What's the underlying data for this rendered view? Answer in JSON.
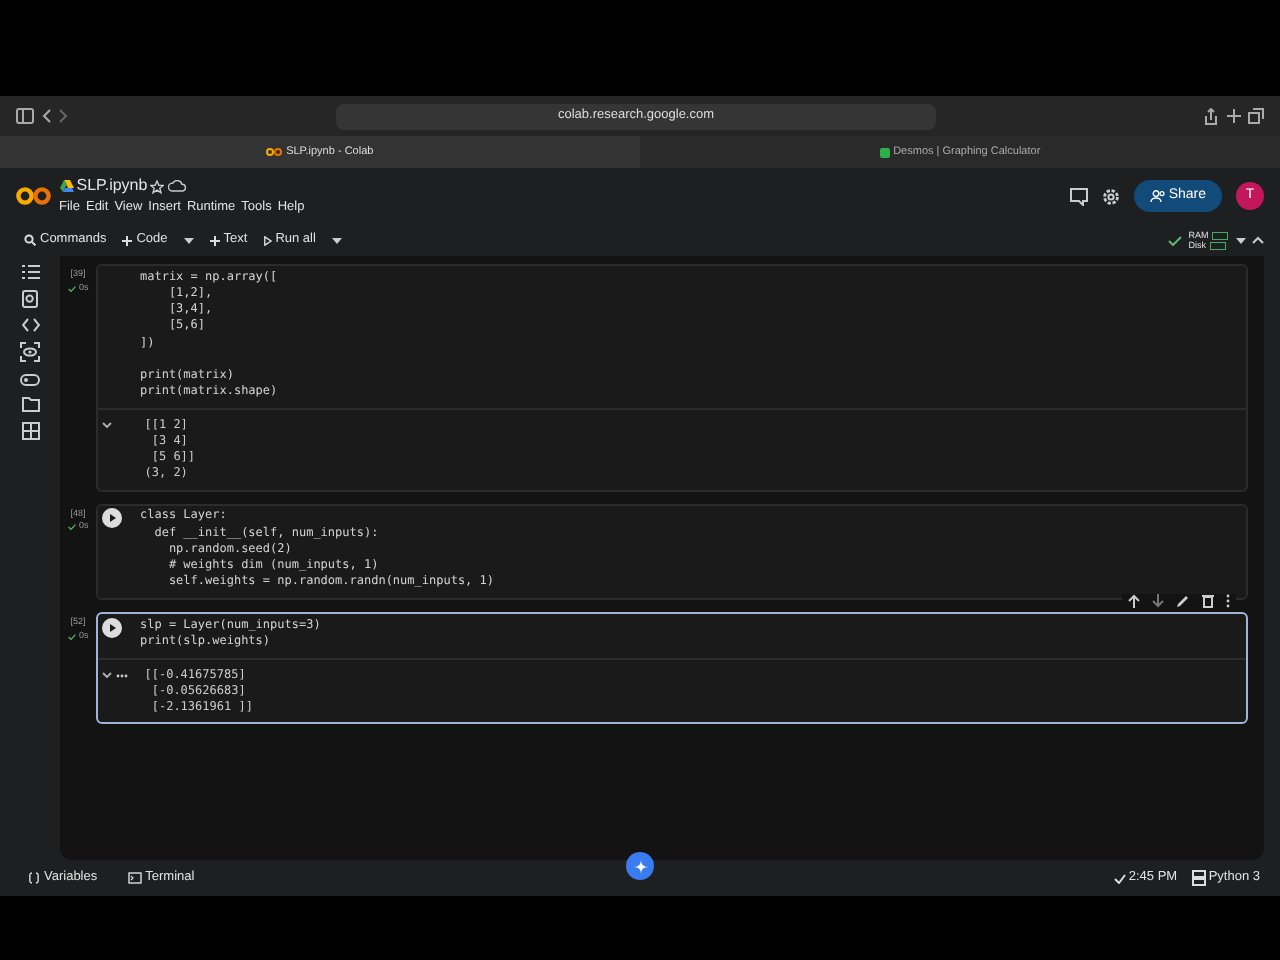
{
  "browser": {
    "url": "colab.research.google.com",
    "tabs": [
      {
        "title": "SLP.ipynb - Colab",
        "selected": true
      },
      {
        "title": "Desmos | Graphing Calculator",
        "selected": false
      }
    ]
  },
  "notebook": {
    "title": "SLP.ipynb",
    "menu": [
      "File",
      "Edit",
      "View",
      "Insert",
      "Runtime",
      "Tools",
      "Help"
    ],
    "share": "Share",
    "avatar": "T"
  },
  "toolbar": {
    "items": [
      "Commands",
      "Code",
      "Text",
      "Run all"
    ],
    "resources": [
      "RAM",
      "Disk"
    ]
  },
  "cells": [
    {
      "count": "[39]",
      "time": "0s",
      "selected": false,
      "code": [
        [
          "matrix = np.array([",
          "    [1,2],",
          "    [3,4],",
          "    [5,6]",
          "])"
        ],
        [
          "print(matrix)",
          "print(matrix.shape)"
        ]
      ],
      "output": [
        "[[1 2]",
        " [3 4]",
        " [5 6]]",
        "(3, 2)"
      ]
    },
    {
      "count": "[48]",
      "time": "0s",
      "selected": false,
      "run_button": true,
      "code": [
        [
          "class Layer:",
          "  def __init__(self, num_inputs):",
          "    np.random.seed(2)",
          "    # weights dim (num_inputs, 1)",
          "    self.weights = np.random.randn(num_inputs, 1)"
        ]
      ]
    },
    {
      "count": "[52]",
      "time": "0s",
      "selected": true,
      "run_button": true,
      "code": [
        [
          "slp = Layer(num_inputs=3)",
          "print(slp.weights)"
        ]
      ],
      "output": [
        "[[-0.41675785]",
        " [-0.05626683]",
        " [-2.1361961 ]]"
      ]
    }
  ],
  "status": {
    "items": [
      "Variables",
      "Terminal"
    ],
    "time": "2:45 PM",
    "runtime": "Python 3"
  }
}
